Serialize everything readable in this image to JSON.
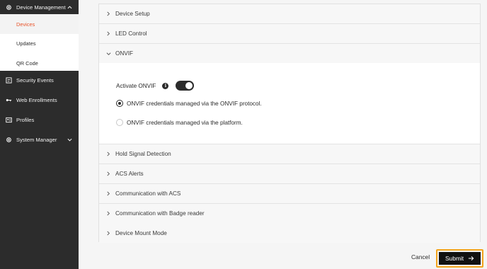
{
  "sidebar": {
    "device_management": "Device Management",
    "submenu": {
      "devices": "Devices",
      "updates": "Updates",
      "qr_code": "QR Code"
    },
    "security_events": "Security Events",
    "web_enrollments": "Web Enrollments",
    "profiles": "Profiles",
    "system_manager": "System Manager"
  },
  "accordion": {
    "device_setup": "Device Setup",
    "led_control": "LED Control",
    "onvif": "ONVIF",
    "hold_signal_detection": "Hold Signal Detection",
    "acs_alerts": "ACS Alerts",
    "communication_with_acs": "Communication with ACS",
    "communication_with_badge_reader": "Communication with Badge reader",
    "device_mount_mode": "Device Mount Mode"
  },
  "onvif_panel": {
    "activate_label": "Activate ONVIF",
    "toggle_on": true,
    "option_protocol": "ONVIF credentials managed via the ONVIF protocol.",
    "option_platform": "ONVIF credentials managed via the platform.",
    "selected_option": "option_protocol"
  },
  "footer": {
    "cancel": "Cancel",
    "submit": "Submit"
  },
  "colors": {
    "sidebar_bg": "#2c2c2c",
    "active_accent": "#e8542b",
    "submit_bg": "#111111",
    "submit_focus_outline": "#f3a41c"
  }
}
